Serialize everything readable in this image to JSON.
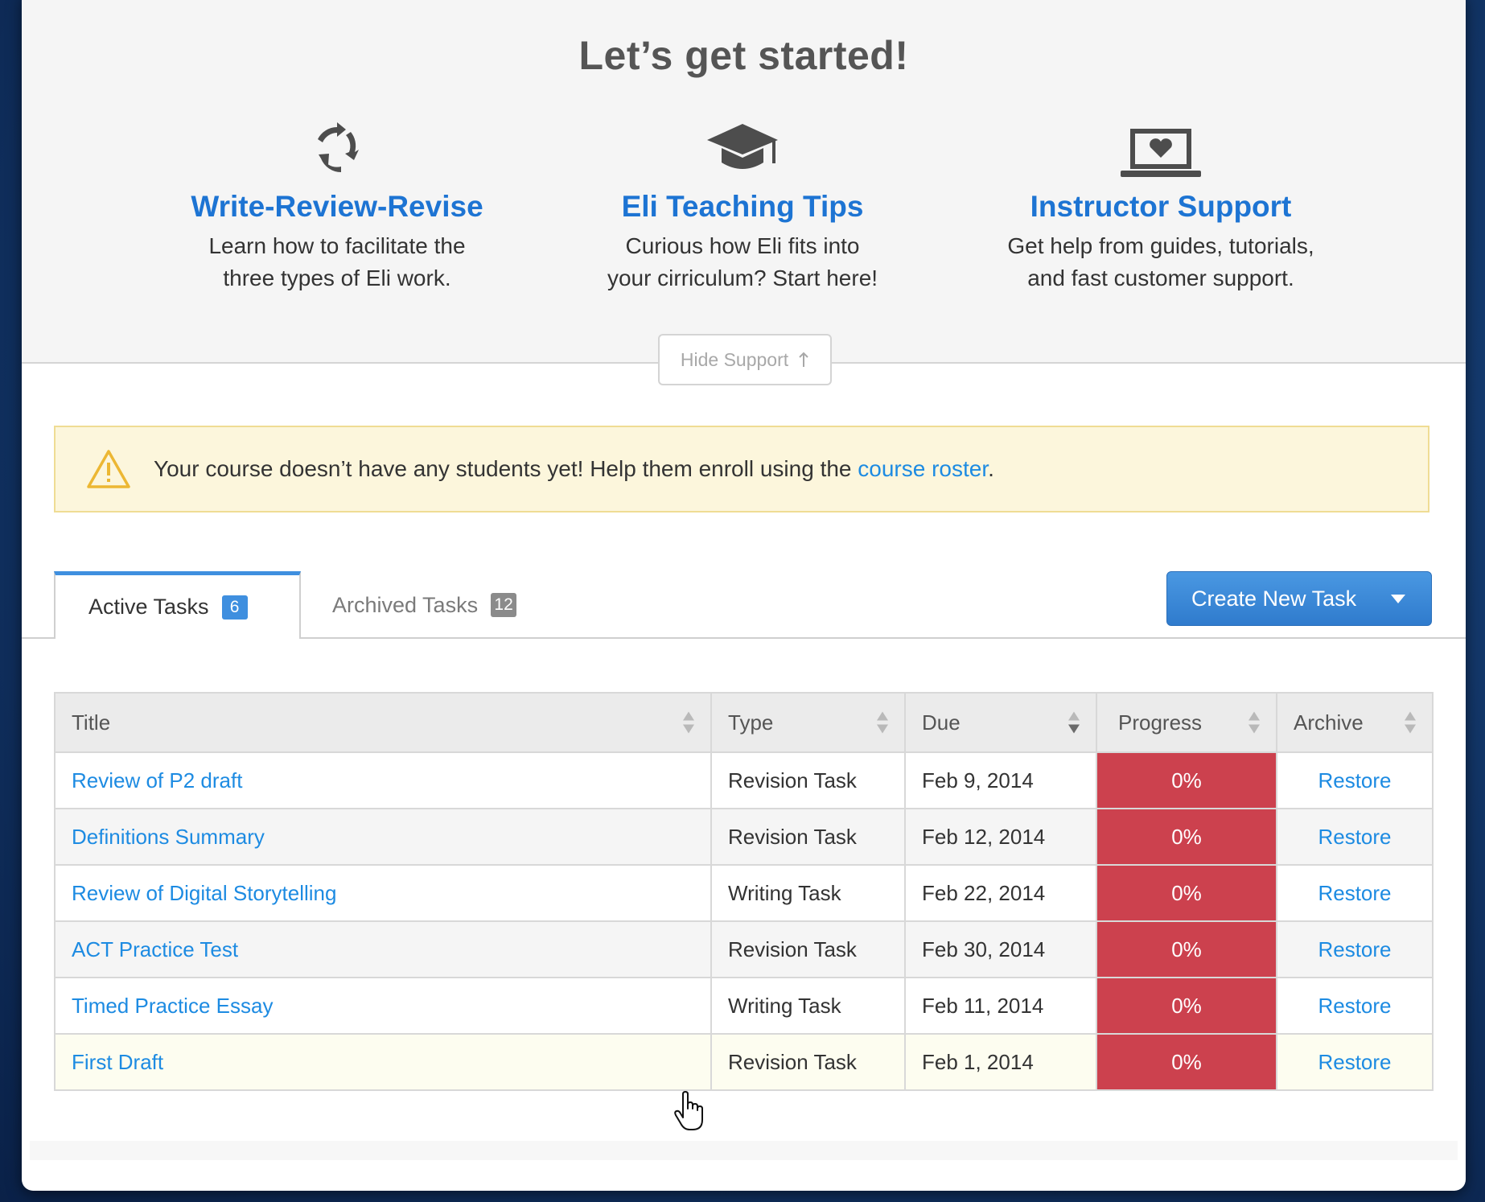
{
  "support": {
    "title": "Let’s get started!",
    "cards": [
      {
        "icon": "cycle-arrows-icon",
        "title": "Write-Review-Revise",
        "description": "Learn how to facilitate the\nthree types of Eli work."
      },
      {
        "icon": "graduation-cap-icon",
        "title": "Eli Teaching Tips",
        "description": "Curious how Eli fits into\nyour cirriculum? Start here!"
      },
      {
        "icon": "laptop-heart-icon",
        "title": "Instructor Support",
        "description": "Get help from guides, tutorials,\nand fast customer support."
      }
    ],
    "hide_label": "Hide Support",
    "hide_icon": "arrow-up-icon"
  },
  "alert": {
    "icon": "warning-icon",
    "text": "Your course doesn’t have any students yet!  Help them enroll using the ",
    "link": "course roster",
    "suffix": "."
  },
  "tabs": [
    {
      "label": "Active Tasks",
      "count": "6",
      "active": true
    },
    {
      "label": "Archived Tasks",
      "count": "12",
      "active": false
    }
  ],
  "create_button": {
    "label": "Create New Task",
    "icon": "caret-down-icon"
  },
  "table": {
    "columns": [
      "Title",
      "Type",
      "Due",
      "Progress",
      "Archive"
    ],
    "sorted_column": "Due",
    "rows": [
      {
        "title": "Review of P2 draft",
        "type": "Revision Task",
        "due": "Feb 9, 2014",
        "progress": "0%",
        "action": "Restore"
      },
      {
        "title": "Definitions Summary",
        "type": "Revision Task",
        "due": "Feb 12, 2014",
        "progress": "0%",
        "action": "Restore"
      },
      {
        "title": "Review of Digital Storytelling",
        "type": "Writing Task",
        "due": "Feb 22, 2014",
        "progress": "0%",
        "action": "Restore"
      },
      {
        "title": "ACT Practice Test",
        "type": "Revision Task",
        "due": "Feb 30, 2014",
        "progress": "0%",
        "action": "Restore"
      },
      {
        "title": "Timed Practice Essay",
        "type": "Writing Task",
        "due": "Feb 11, 2014",
        "progress": "0%",
        "action": "Restore"
      },
      {
        "title": "First Draft",
        "type": "Revision Task",
        "due": "Feb 1, 2014",
        "progress": "0%",
        "action": "Restore"
      }
    ]
  },
  "colors": {
    "link_blue": "#1d74d3",
    "accent_blue": "#3f8fdf",
    "progress_red": "#cc414e",
    "alert_bg": "#fcf6dc"
  },
  "cursor_icon": "hand-pointer-icon"
}
